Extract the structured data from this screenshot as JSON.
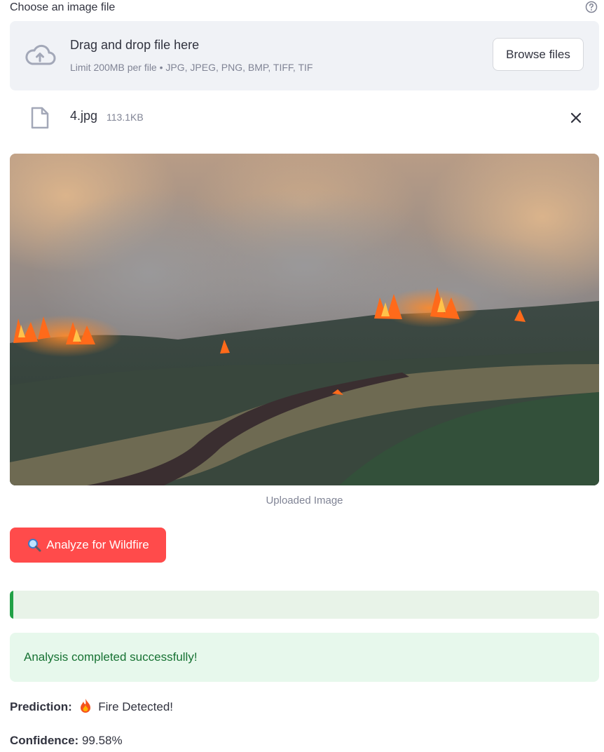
{
  "uploader": {
    "label": "Choose an image file",
    "dropzone_title": "Drag and drop file here",
    "dropzone_subtitle": "Limit 200MB per file • JPG, JPEG, PNG, BMP, TIFF, TIF",
    "browse_label": "Browse files",
    "help_icon": "question-circle-icon",
    "cloud_icon": "cloud-upload-icon"
  },
  "file": {
    "name": "4.jpg",
    "size": "113.1KB",
    "icon": "file-icon",
    "remove_icon": "close-icon"
  },
  "image": {
    "caption": "Uploaded Image"
  },
  "analyze": {
    "label": "Analyze for Wildfire",
    "icon": "magnifier-icon",
    "color": "#FF4B4B"
  },
  "progress": {
    "value": 0.0,
    "color": "#21A146"
  },
  "status": {
    "message": "Analysis completed successfully!"
  },
  "result": {
    "prediction_label": "Prediction:",
    "prediction_value": "Fire Detected!",
    "prediction_icon": "fire-icon",
    "confidence_label": "Confidence:",
    "confidence_value": "99.58%"
  }
}
